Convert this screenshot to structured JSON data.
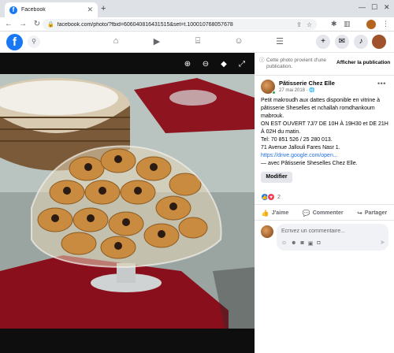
{
  "browser": {
    "tab_title": "Facebook",
    "tab_favicon": "f",
    "url": "facebook.com/photo/?fbid=606040816431515&set=t.100010768057678"
  },
  "facebook": {
    "logo": "f"
  },
  "side": {
    "notice_text": "Cette photo provient d'une publication.",
    "show_post_label": "Afficher la publication",
    "page_name": "Pâtisserie Chez Elle",
    "post_date": "27 mai 2018 · ",
    "post_lines": [
      "Petit makroudh aux dattes disponible en vitrine à pâtisserie Sheselles et nchallah romdhankoum mabrouk.",
      "ON EST OUVERT 7J/7 DE 10H À 19H30 et DE 21H À 02H du matin.",
      "Tel: 70 851 526 / 25 280 013.",
      "71 Avenue Jallouli Fares Nasr 1."
    ],
    "post_link": "https://drive.google.com/open...",
    "post_with": "— avec Pâtisserie Sheselles Chez Elle.",
    "edit_label": "Modifier",
    "reaction_count": "2",
    "actions": {
      "like": "J'aime",
      "comment": "Commenter",
      "share": "Partager"
    },
    "comment_placeholder": "Écrivez un commentaire..."
  }
}
